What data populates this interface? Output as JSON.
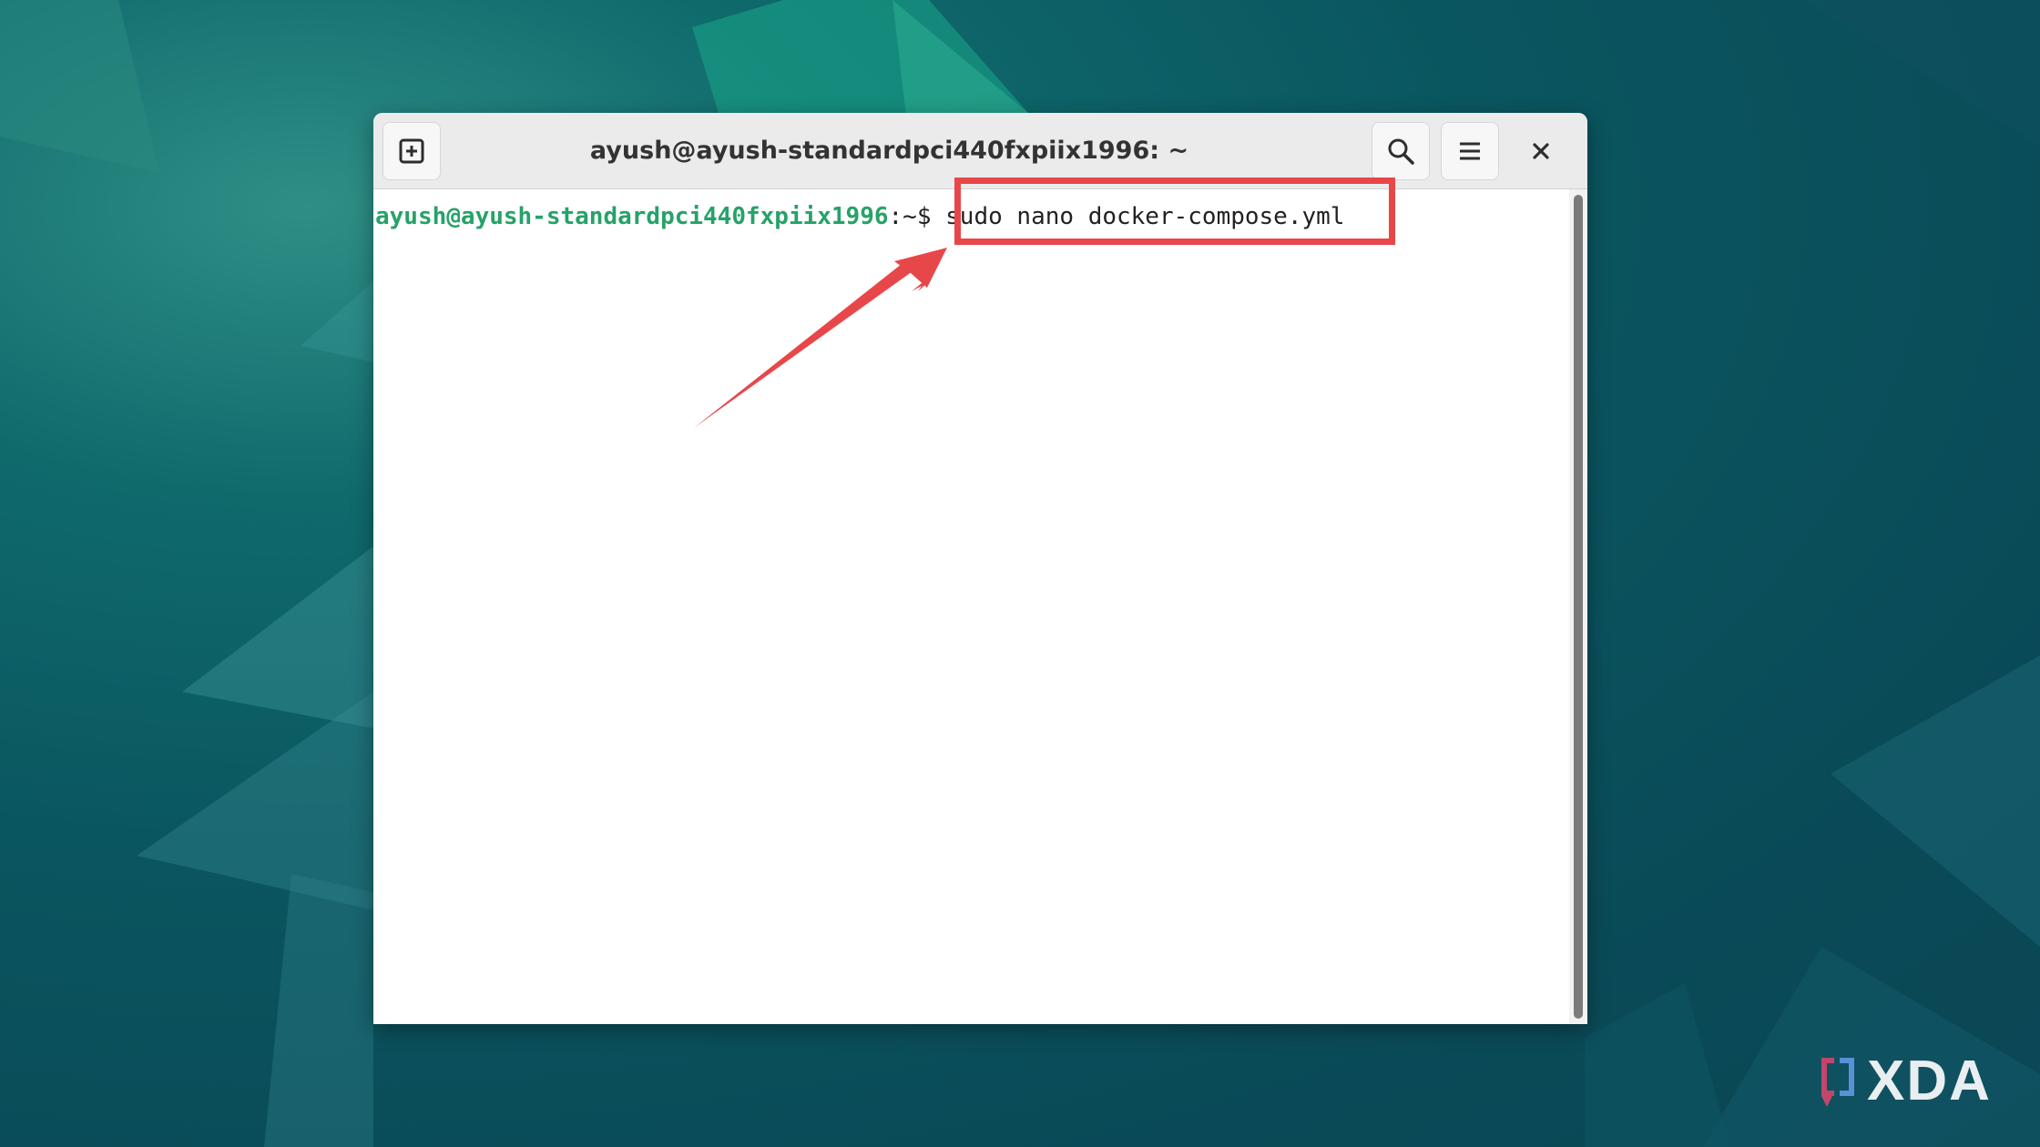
{
  "window": {
    "title": "ayush@ayush-standardpci440fxpiix1996: ~"
  },
  "titlebar": {
    "new_tab_icon": "new-tab-icon",
    "search_icon": "search-icon",
    "menu_icon": "hamburger-menu-icon",
    "close_icon": "close-icon"
  },
  "terminal": {
    "prompt_user_host": "ayush@ayush-standardpci440fxpiix1996",
    "prompt_path": ":~$ ",
    "command": "sudo nano docker-compose.yml"
  },
  "annotation": {
    "highlight_color": "#e8474a"
  },
  "watermark": {
    "brand": "XDA"
  },
  "colors": {
    "prompt_green": "#26a269",
    "desktop_teal": "#0a5660"
  }
}
